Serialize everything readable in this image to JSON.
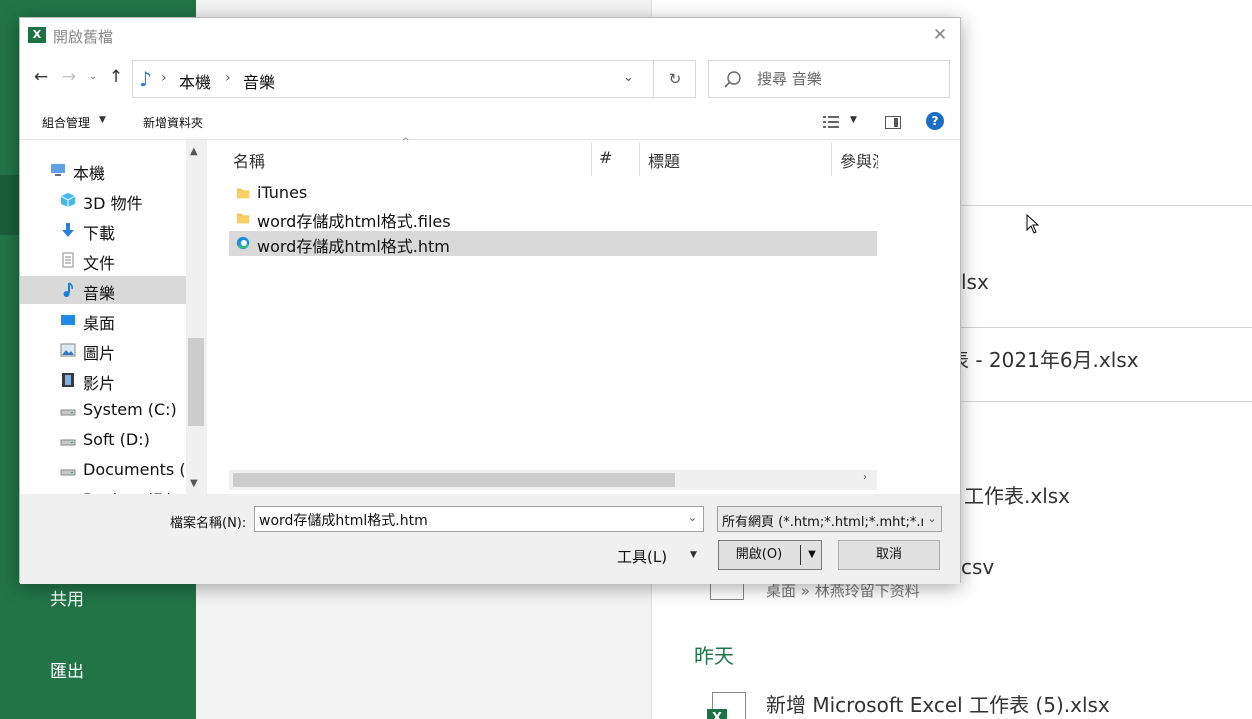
{
  "backstage": {
    "nav": {
      "share": "共用",
      "export": "匯出"
    },
    "recent_files": [
      {
        "name": "lsx"
      },
      {
        "name": "表 - 2021年6月.xlsx"
      },
      {
        "name": "工作表.xlsx"
      },
      {
        "name": "csv",
        "path": "桌面 » 林燕玲留下资料"
      }
    ],
    "section_yesterday": "昨天",
    "yesterday_files": [
      {
        "name": "新增 Microsoft Excel 工作表 (5).xlsx"
      }
    ]
  },
  "dialog": {
    "title": "開啟舊檔",
    "close_glyph": "✕",
    "address": {
      "crumbs": [
        "本機",
        "音樂"
      ]
    },
    "search": {
      "placeholder": "搜尋 音樂"
    },
    "toolbar": {
      "organize": "組合管理",
      "new_folder": "新增資料夾"
    },
    "nav_tree": [
      {
        "label": "本機",
        "icon": "computer-icon"
      },
      {
        "label": "3D 物件",
        "icon": "3d-objects-icon"
      },
      {
        "label": "下載",
        "icon": "download-icon"
      },
      {
        "label": "文件",
        "icon": "document-icon"
      },
      {
        "label": "音樂",
        "icon": "music-icon",
        "selected": true
      },
      {
        "label": "桌面",
        "icon": "desktop-icon"
      },
      {
        "label": "圖片",
        "icon": "pictures-icon"
      },
      {
        "label": "影片",
        "icon": "videos-icon"
      },
      {
        "label": "System (C:)",
        "icon": "drive-icon"
      },
      {
        "label": "Soft (D:)",
        "icon": "drive-icon"
      },
      {
        "label": "Documents (I",
        "icon": "drive-icon"
      },
      {
        "label": "Backup (F:)",
        "icon": "drive-icon"
      }
    ],
    "columns": [
      "名稱",
      "#",
      "標題",
      "參與演"
    ],
    "files": [
      {
        "name": "iTunes",
        "icon": "folder-icon"
      },
      {
        "name": "word存儲成html格式.files",
        "icon": "folder-icon"
      },
      {
        "name": "word存儲成html格式.htm",
        "icon": "edge-icon",
        "selected": true
      }
    ],
    "filename_label": "檔案名稱(N):",
    "filename_value": "word存儲成html格式.htm",
    "filter_value": "所有網頁 (*.htm;*.html;*.mht;*.mhtml)",
    "tools_label": "工具(L)",
    "open_label": "開啟(O)",
    "cancel_label": "取消"
  },
  "colors": {
    "excel_green": "#227447",
    "selection_gray": "#d9d9d9",
    "music_blue": "#1f7fd6"
  }
}
